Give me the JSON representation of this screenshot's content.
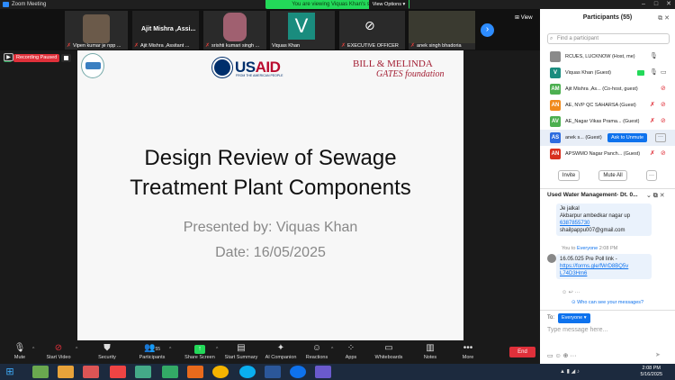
{
  "app": {
    "title": "Zoom Meeting"
  },
  "banner": {
    "text": "You are viewing Viquas Khan's screen",
    "view_options": "View Options"
  },
  "gallery": {
    "tiles": [
      {
        "name": "Vipen kumar je  npp ..."
      },
      {
        "name": "Ajit Mishra ,Assitant ..."
      },
      {
        "name": "srishti kumari singh ..."
      },
      {
        "name": "Viquas Khan"
      },
      {
        "name": "EXECUTIVE OFFICER"
      },
      {
        "name": "anek singh bhadoria"
      }
    ],
    "big_name": "Ajit Mishra ,Assi...",
    "avatar_letter": "V",
    "view_label": "View"
  },
  "recording": {
    "label": "Recording Paused"
  },
  "slide": {
    "title_line1": "Design Review of Sewage",
    "title_line2": "Treatment Plant Components",
    "presented_by": "Presented by: Viquas Khan",
    "date": "Date: 16/05/2025",
    "usaid_prefix": "US",
    "usaid_suffix": "AID",
    "usaid_sub": "FROM THE AMERICAN PEOPLE",
    "bmg_line1": "BILL & MELINDA",
    "bmg_line2": "GATES foundation"
  },
  "toolbar": {
    "mute": "Mute",
    "start_video": "Start Video",
    "security": "Security",
    "participants": "Participants",
    "participants_count": "55",
    "share_screen": "Share Screen",
    "start_summary": "Start Summary",
    "ai_companion": "AI Companion",
    "reactions": "Reactions",
    "apps": "Apps",
    "whiteboards": "Whiteboards",
    "notes": "Notes",
    "more": "More",
    "end": "End"
  },
  "participants_panel": {
    "title": "Participants (55)",
    "find_placeholder": "Find a participant",
    "rows": [
      {
        "initials": "",
        "color": "#8a8a8a",
        "name": "RCUES, LUCKNOW (Host, me)"
      },
      {
        "initials": "V",
        "color": "#1a8c7e",
        "name": "Viquas Khan (Guest)"
      },
      {
        "initials": "AM",
        "color": "#4caf50",
        "name": "Ajit Mishra ,As... (Co-host, guest)"
      },
      {
        "initials": "AN",
        "color": "#f08a1c",
        "name": "AE, NVP QC SAHARSA (Guest)"
      },
      {
        "initials": "AV",
        "color": "#4caf50",
        "name": "AE_Nagar Vikas Prama...  (Guest)"
      },
      {
        "initials": "AS",
        "color": "#2d6cdf",
        "name": "anek s... (Guest)"
      },
      {
        "initials": "AN",
        "color": "#d8301f",
        "name": "APSWMO Nagar Panch... (Guest)"
      }
    ],
    "ask_to_unmute": "Ask to Unmute",
    "invite": "Invite",
    "mute_all": "Mute All"
  },
  "chat": {
    "title": "Used Water Management-  Dt. 0...",
    "msg1_lines": [
      "Je jalkal",
      "Akbarpur ambedkar nagar up"
    ],
    "msg1_link": "6387855730",
    "msg1_email": "shailpappu007@gmail.com",
    "meta_you": "You to",
    "meta_to": "Everyone",
    "meta_time": "2:08 PM",
    "msg2_text": "16.05.025 Pre Poll link -",
    "msg2_link1": "https://forms.gle/fWrD8BQ5v",
    "msg2_link2": "L74D3Hm6",
    "who_can_see": "Who can see your messages?",
    "to_label": "To:",
    "to_value": "Everyone",
    "placeholder": "Type message here..."
  },
  "taskbar": {
    "time": "2:08 PM",
    "date": "5/16/2025"
  }
}
